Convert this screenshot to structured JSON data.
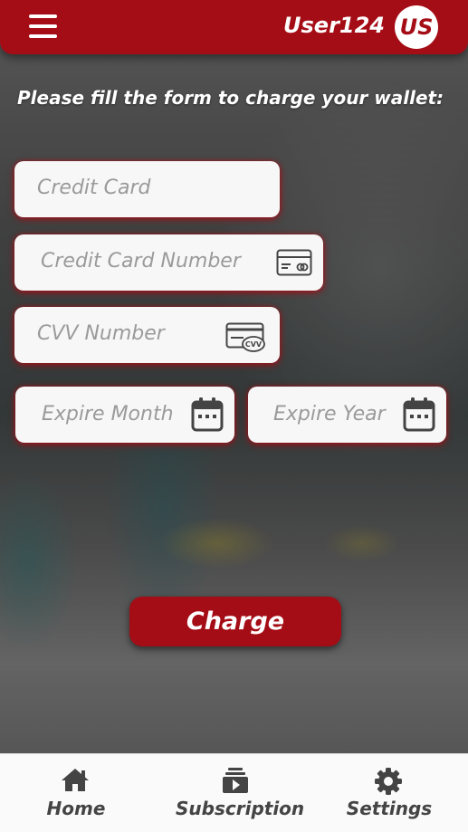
{
  "header": {
    "username": "User124",
    "avatar_initials": "US",
    "accent_color": "#a50d16"
  },
  "form": {
    "instruction": "Please fill the form to charge your wallet:",
    "credit_card_placeholder": "Credit Card",
    "card_number_placeholder": "Credit Card Number",
    "card_number_icon": "credit-card-icon",
    "cvv_placeholder": "CVV Number",
    "cvv_icon": "cvv-card-icon",
    "expire_month_placeholder": "Expire Month",
    "expire_year_placeholder": "Expire Year",
    "expire_icon": "calendar-icon",
    "submit_label": "Charge"
  },
  "footer": {
    "items": [
      {
        "label": "Home",
        "icon": "home-icon"
      },
      {
        "label": "Subscription",
        "icon": "subscription-icon"
      },
      {
        "label": "Settings",
        "icon": "gear-icon"
      }
    ]
  }
}
